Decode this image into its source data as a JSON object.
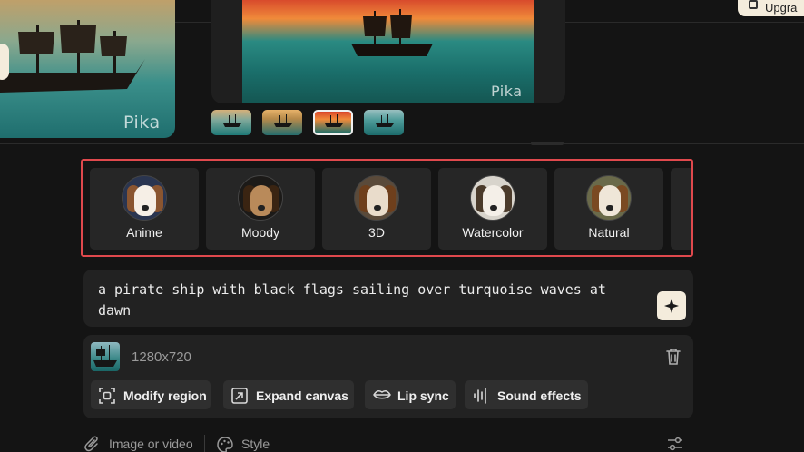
{
  "header": {
    "upgrade_label": "Upgra"
  },
  "preview": {
    "watermark": "Pika"
  },
  "styles": [
    {
      "label": "Anime"
    },
    {
      "label": "Moody"
    },
    {
      "label": "3D"
    },
    {
      "label": "Watercolor"
    },
    {
      "label": "Natural"
    }
  ],
  "prompt": {
    "text": "a pirate ship with black flags sailing over turquoise waves at dawn"
  },
  "image": {
    "dimensions": "1280x720"
  },
  "tools": {
    "modify_region": "Modify region",
    "expand_canvas": "Expand canvas",
    "lip_sync": "Lip sync",
    "sound_effects": "Sound effects"
  },
  "footer": {
    "attach_label": "Image or video",
    "style_label": "Style"
  },
  "colors": {
    "accent": "#f4ecdc",
    "highlight_border": "#e0494d",
    "background": "#141414"
  },
  "icons": [
    "crown-icon",
    "sparkle-icon",
    "trash-icon",
    "modify-region-icon",
    "expand-canvas-icon",
    "lips-icon",
    "waveform-icon",
    "paperclip-icon",
    "palette-icon",
    "settings-sliders-icon"
  ]
}
